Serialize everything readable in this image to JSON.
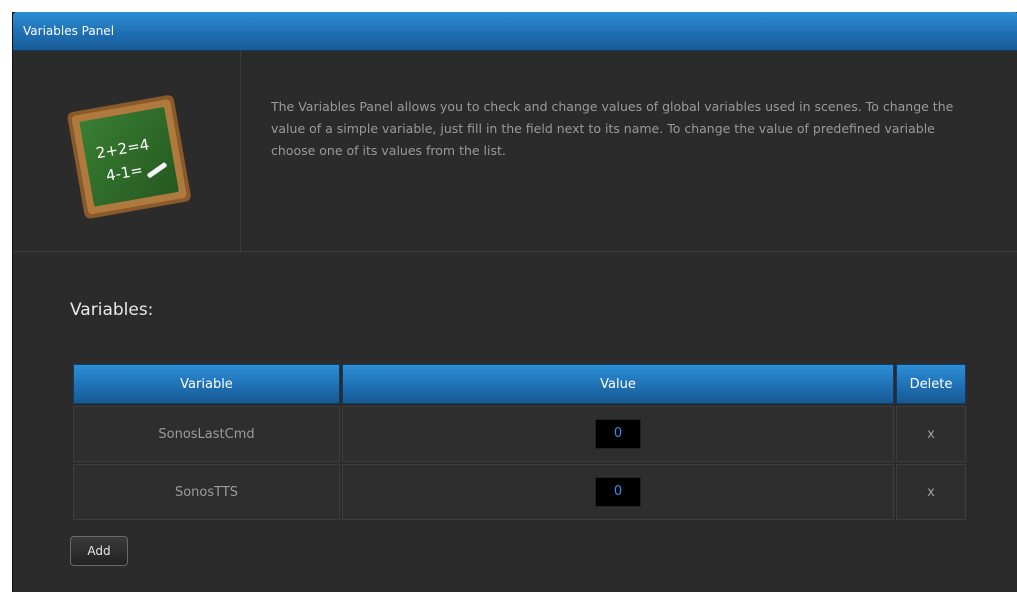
{
  "panel": {
    "title": "Variables Panel",
    "description": "The Variables Panel allows you to check and change values of global variables used in scenes. To change the value of a simple variable, just fill in the field next to its name. To change the value of predefined variable choose one of its values from the list.",
    "icon": "chalkboard-icon",
    "chalkboard_text": [
      "2+2=4",
      "4-1="
    ]
  },
  "variables": {
    "section_title": "Variables:",
    "columns": {
      "variable": "Variable",
      "value": "Value",
      "delete": "Delete"
    },
    "rows": [
      {
        "name": "SonosLastCmd",
        "value": "0",
        "delete": "x"
      },
      {
        "name": "SonosTTS",
        "value": "0",
        "delete": "x"
      }
    ],
    "add_label": "Add"
  },
  "colors": {
    "header_blue": "#1f6fb3",
    "panel_bg": "#2b2b2b",
    "input_bg": "#000000",
    "input_text": "#3a8ee6"
  }
}
